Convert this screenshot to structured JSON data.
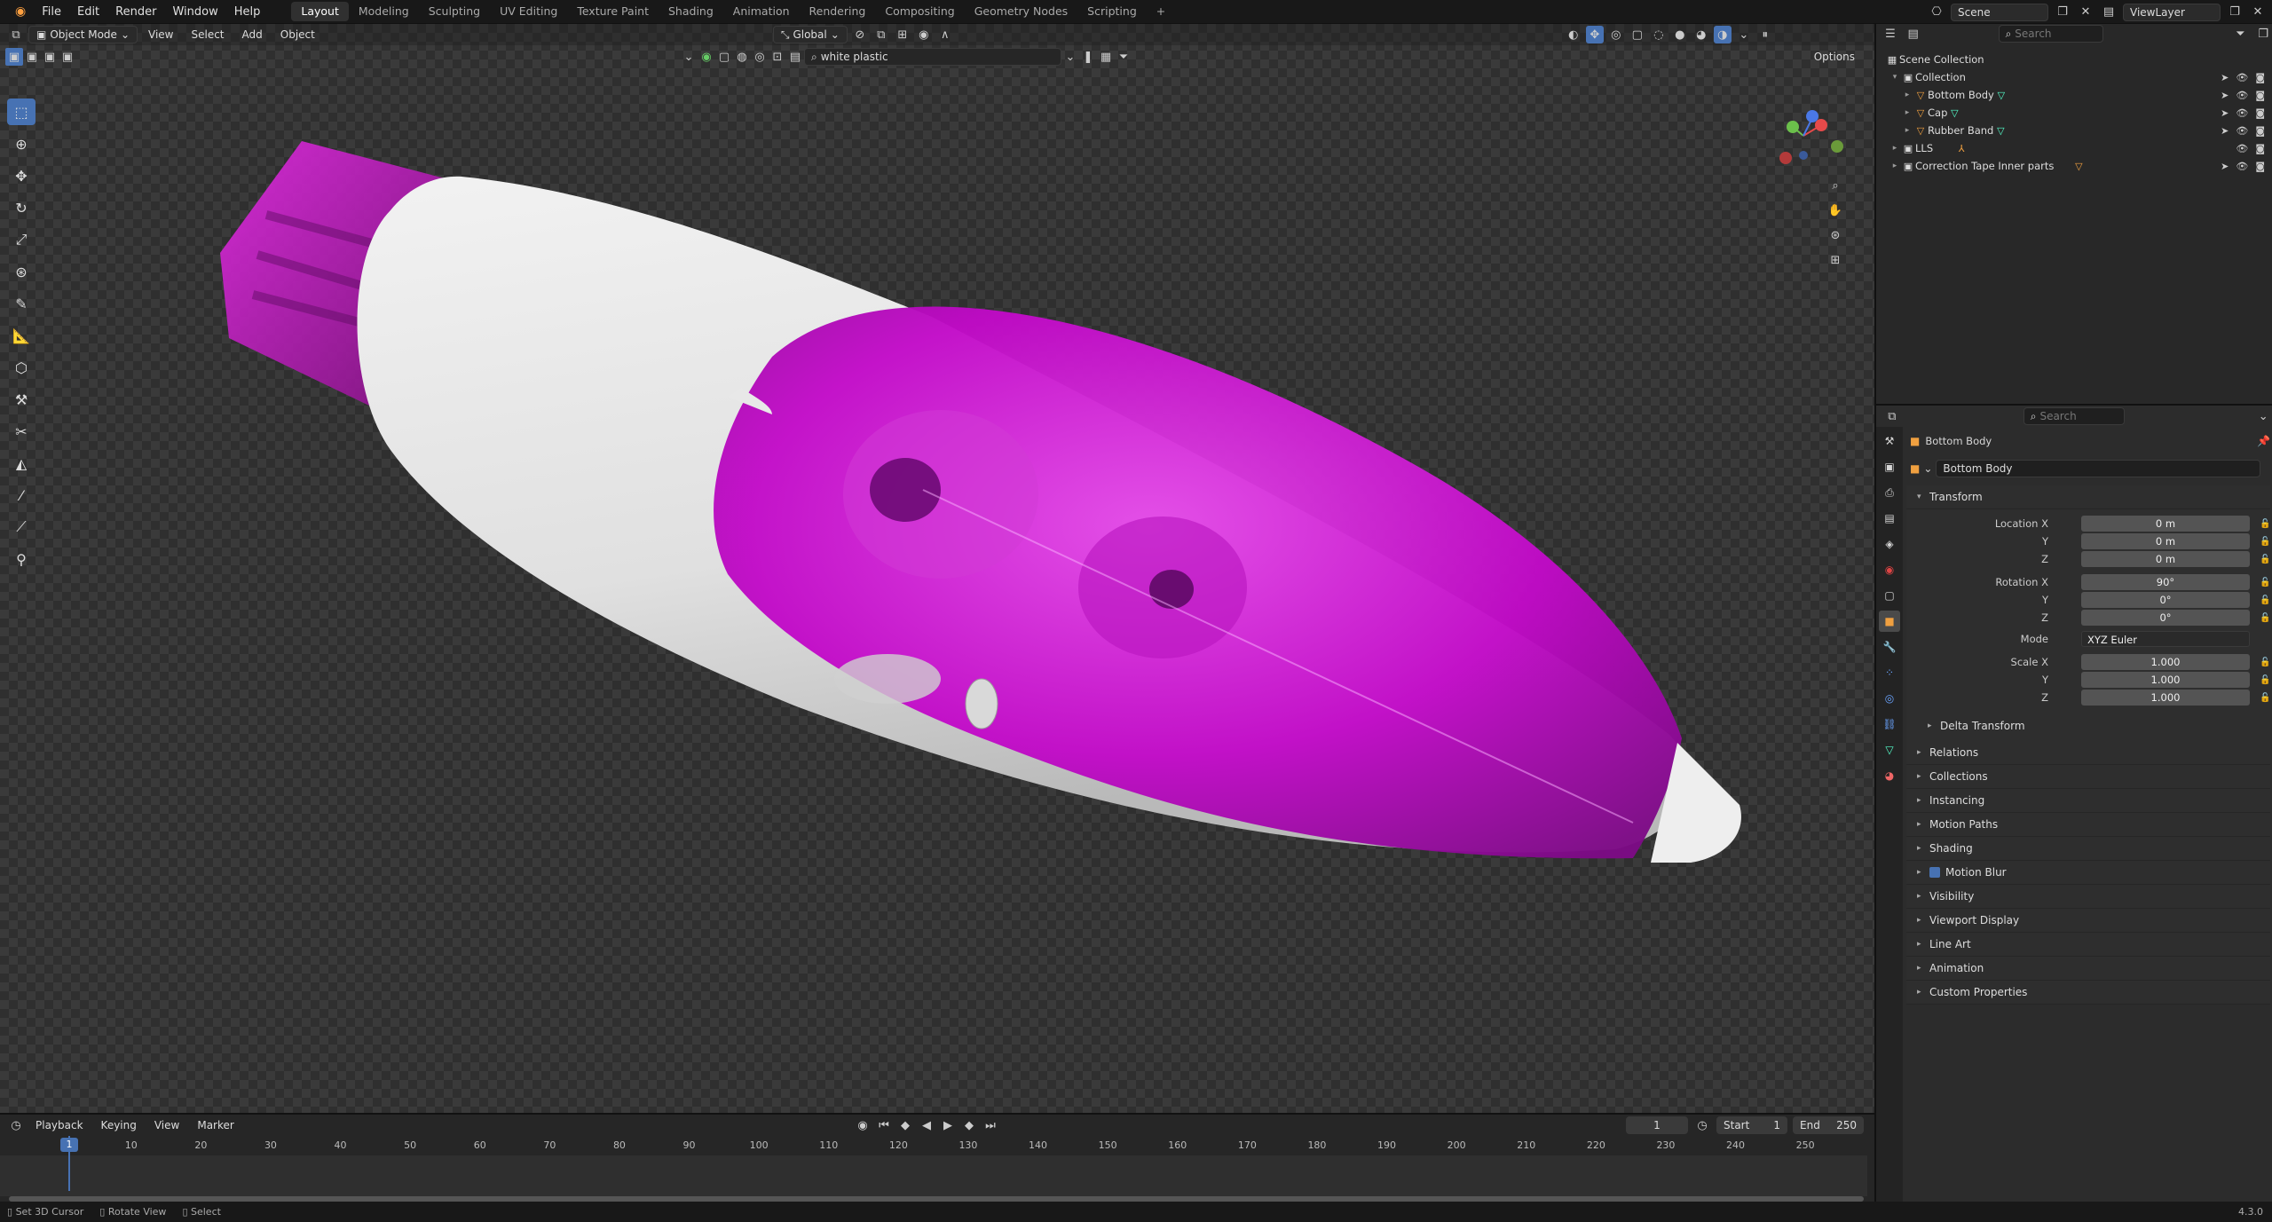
{
  "topbar": {
    "menus": [
      "File",
      "Edit",
      "Render",
      "Window",
      "Help"
    ],
    "workspaces": [
      "Layout",
      "Modeling",
      "Sculpting",
      "UV Editing",
      "Texture Paint",
      "Shading",
      "Animation",
      "Rendering",
      "Compositing",
      "Geometry Nodes",
      "Scripting"
    ],
    "active_workspace": "Layout",
    "add_tab": "+",
    "scene_label": "Scene",
    "viewlayer_label": "ViewLayer"
  },
  "viewport": {
    "mode": "Object Mode",
    "menus": [
      "View",
      "Select",
      "Add",
      "Object"
    ],
    "orientation": "Global",
    "material_filter": "white plastic",
    "options_label": "Options"
  },
  "outliner": {
    "search_placeholder": "Search",
    "scene_collection": "Scene Collection",
    "items": [
      {
        "label": "Collection",
        "level": 1
      },
      {
        "label": "Bottom Body",
        "level": 2
      },
      {
        "label": "Cap",
        "level": 2
      },
      {
        "label": "Rubber Band",
        "level": 2
      },
      {
        "label": "LLS",
        "level": 1
      },
      {
        "label": "Correction Tape Inner parts",
        "level": 1
      }
    ]
  },
  "properties": {
    "search_placeholder": "Search",
    "object_name": "Bottom Body",
    "data_name": "Bottom Body",
    "transform_label": "Transform",
    "location_label": "Location X",
    "rotation_label": "Rotation X",
    "scale_label": "Scale X",
    "axis_y": "Y",
    "axis_z": "Z",
    "location": [
      "0 m",
      "0 m",
      "0 m"
    ],
    "rotation": [
      "90°",
      "0°",
      "0°"
    ],
    "mode_label": "Mode",
    "mode_value": "XYZ Euler",
    "scale": [
      "1.000",
      "1.000",
      "1.000"
    ],
    "delta_transform": "Delta Transform",
    "panels": [
      "Relations",
      "Collections",
      "Instancing",
      "Motion Paths",
      "Shading",
      "Motion Blur",
      "Visibility",
      "Viewport Display",
      "Line Art",
      "Animation",
      "Custom Properties"
    ]
  },
  "timeline": {
    "menus": [
      "Playback",
      "Keying",
      "View",
      "Marker"
    ],
    "current_frame": "1",
    "start_label": "Start",
    "start_value": "1",
    "end_label": "End",
    "end_value": "250",
    "ticks": [
      "1",
      "10",
      "20",
      "30",
      "40",
      "50",
      "60",
      "70",
      "80",
      "90",
      "100",
      "110",
      "120",
      "130",
      "140",
      "150",
      "160",
      "170",
      "180",
      "190",
      "200",
      "210",
      "220",
      "230",
      "240",
      "250"
    ]
  },
  "statusbar": {
    "items": [
      "Set 3D Cursor",
      "Rotate View",
      "Select"
    ],
    "version": "4.3.0"
  },
  "colors": {
    "accent": "#4772b3",
    "magenta": "#c000c8",
    "white_plastic": "#e8e8e8"
  }
}
